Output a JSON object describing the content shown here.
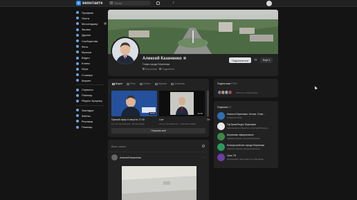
{
  "header": {
    "logo_text": "вконтакте",
    "search_placeholder": "Поиск"
  },
  "sidebar": {
    "items": [
      {
        "label": "Профиль"
      },
      {
        "label": "Лента"
      },
      {
        "label": "Мессенджер",
        "badge": "1"
      },
      {
        "label": "Звонки"
      },
      {
        "label": "Друзья"
      },
      {
        "label": "Сообщества"
      },
      {
        "label": "Фото"
      },
      {
        "label": "Музыка"
      },
      {
        "label": "Видео"
      },
      {
        "label": "Клипы"
      },
      {
        "label": "Игры"
      },
      {
        "label": "Стикеры"
      },
      {
        "label": "Маркет"
      }
    ],
    "items2": [
      {
        "label": "Сервисы"
      },
      {
        "label": "Помощь"
      },
      {
        "label": "Яндекс Браузер"
      }
    ],
    "items3": [
      {
        "label": "Закладки"
      },
      {
        "label": "Файлы"
      },
      {
        "label": "Реклама"
      },
      {
        "label": "Помощь"
      }
    ]
  },
  "profile": {
    "name": "Алексей Казаченко",
    "status": "Глава города Березники",
    "city": "Березники",
    "details": "Подробнее",
    "subscribe_label": "Подписаться",
    "more_label": "Ещё"
  },
  "videos": {
    "tabs": [
      "Видео",
      "Фото",
      "Клипы",
      "Музыка",
      "Альбомы"
    ],
    "items": [
      {
        "title": "Прямой эфир 6 августа 17:30",
        "meta": "5,2 тыс просмотров · 22 сек назад",
        "duration": "35:56"
      },
      {
        "title": "Live",
        "meta": "14 тыс просмотров · 7 месяцев назад",
        "duration": "22:03"
      }
    ],
    "next_title": "Се",
    "show_all_label": "Показать всё"
  },
  "posts": {
    "header": "Ваши записи",
    "author": "Алексей Казаченко"
  },
  "subscribers": {
    "title": "Подписчики",
    "count": "8 591",
    "text": "Никого из общей друж"
  },
  "subscriptions": {
    "title": "Подписки",
    "count": "41",
    "groups": [
      {
        "name": "Новости Березники. Усолье. Соли...",
        "desc": "Открытая тема",
        "color": "#2f6fb3"
      },
      {
        "name": "ГорТрансРесурс Березники",
        "desc": "Акционерное общество «ГорТрансРесурс»",
        "color": "#e8e8e8"
      },
      {
        "name": "Березники официальные",
        "desc": "Администрация города Березники",
        "color": "#3a8a46"
      },
      {
        "name": "Благоустройство города Березники",
        "desc": "Администрация города Березники",
        "color": "#2a9a5a"
      },
      {
        "name": "Свое ТВ",
        "desc": "Присылайте свои новости в Whatsapp",
        "color": "#6a3fa0"
      }
    ]
  }
}
